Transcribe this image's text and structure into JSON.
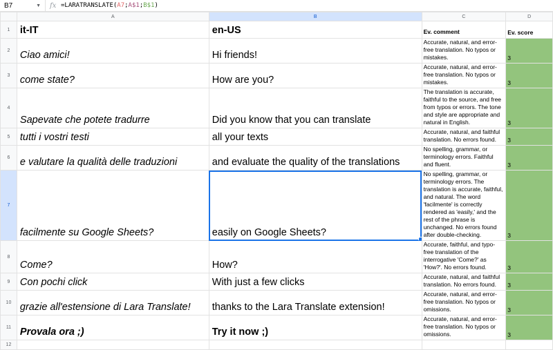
{
  "formula_bar": {
    "cell_ref": "B7",
    "fx_label": "fx",
    "formula_prefix": "=LARATRANSLATE(",
    "formula_ref1": "A7",
    "formula_sep1": ";",
    "formula_ref2": "A$1",
    "formula_sep2": ";",
    "formula_ref3": "B$1",
    "formula_suffix": ")"
  },
  "columns": [
    "A",
    "B",
    "C",
    "D"
  ],
  "header_row": {
    "num": "1",
    "a": "it-IT",
    "b": "en-US",
    "c": "Ev. comment",
    "d": "Ev. score"
  },
  "rows": [
    {
      "num": "2",
      "a": "Ciao amici!",
      "b": "Hi friends!",
      "c": "Accurate, natural, and error-free translation. No typos or mistakes.",
      "d": "3"
    },
    {
      "num": "3",
      "a": "come state?",
      "b": "How are you?",
      "c": "Accurate, natural, and error-free translation. No typos or mistakes.",
      "d": "3"
    },
    {
      "num": "4",
      "a": "Sapevate che potete tradurre",
      "b": "Did you know that you can translate",
      "c": "The translation is accurate, faithful to the source, and free from typos or errors. The tone and style are appropriate and natural in English.",
      "d": "3"
    },
    {
      "num": "5",
      "a": "tutti i vostri testi",
      "b": "all your texts",
      "c": "Accurate, natural, and faithful translation. No errors found.",
      "d": "3"
    },
    {
      "num": "6",
      "a": "e valutare la qualità delle traduzioni",
      "b": "and evaluate the quality of the translations",
      "c": "No spelling, grammar, or terminology errors. Faithful and fluent.",
      "d": "3"
    },
    {
      "num": "7",
      "a": "facilmente su Google Sheets?",
      "b": "easily on Google Sheets?",
      "c": "No spelling, grammar, or terminology errors. The translation is accurate, faithful, and natural. The word 'facilmente' is correctly rendered as 'easily,' and the rest of the phrase is unchanged. No errors found after double-checking.",
      "d": "3"
    },
    {
      "num": "8",
      "a": "Come?",
      "b": "How?",
      "c": "Accurate, faithful, and typo-free translation of the interrogative 'Come?' as 'How?'. No errors found.",
      "d": "3"
    },
    {
      "num": "9",
      "a": "Con pochi click",
      "b": "With just a few clicks",
      "c": "Accurate, natural, and faithful translation. No errors found.",
      "d": "3"
    },
    {
      "num": "10",
      "a": "grazie all'estensione di Lara Translate!",
      "b": "thanks to the Lara Translate extension!",
      "c": "Accurate, natural, and error-free translation. No typos or omissions.",
      "d": "3"
    },
    {
      "num": "11",
      "a": "Provala ora ;)",
      "b": "Try it now ;)",
      "c": "Accurate, natural, and error-free translation. No typos or omissions.",
      "d": "3"
    }
  ],
  "empty_row": {
    "num": "12"
  }
}
